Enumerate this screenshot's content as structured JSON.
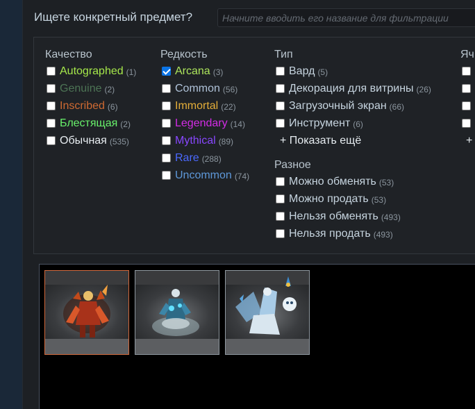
{
  "search": {
    "label": "Ищете конкретный предмет?",
    "placeholder": "Начните вводить его название для фильтрации"
  },
  "quality": {
    "title": "Качество",
    "items": [
      {
        "label": "Autographed",
        "count": "(1)",
        "color": "#a6e84a",
        "checked": false
      },
      {
        "label": "Genuine",
        "count": "(2)",
        "color": "#4d7455",
        "checked": false
      },
      {
        "label": "Inscribed",
        "count": "(6)",
        "color": "#cf6a32",
        "checked": false
      },
      {
        "label": "Блестящая",
        "count": "(2)",
        "color": "#68f16b",
        "checked": false
      },
      {
        "label": "Обычная",
        "count": "(535)",
        "color": "#e8edf1",
        "checked": false
      }
    ]
  },
  "rarity": {
    "title": "Редкость",
    "items": [
      {
        "label": "Arcana",
        "count": "(3)",
        "color": "#ade55c",
        "checked": true
      },
      {
        "label": "Common",
        "count": "(56)",
        "color": "#b0c3d9",
        "checked": false
      },
      {
        "label": "Immortal",
        "count": "(22)",
        "color": "#e4ae39",
        "checked": false
      },
      {
        "label": "Legendary",
        "count": "(14)",
        "color": "#d32ce6",
        "checked": false
      },
      {
        "label": "Mythical",
        "count": "(89)",
        "color": "#8847ff",
        "checked": false
      },
      {
        "label": "Rare",
        "count": "(288)",
        "color": "#4b69ff",
        "checked": false
      },
      {
        "label": "Uncommon",
        "count": "(74)",
        "color": "#5e98d9",
        "checked": false
      }
    ]
  },
  "type": {
    "title": "Тип",
    "items": [
      {
        "label": "Вард",
        "count": "(5)"
      },
      {
        "label": "Декорация для витрины",
        "count": "(26)"
      },
      {
        "label": "Загрузочный экран",
        "count": "(66)"
      },
      {
        "label": "Инструмент",
        "count": "(6)"
      }
    ],
    "show_more": "+ Показать ещё"
  },
  "misc": {
    "title": "Разное",
    "items": [
      {
        "label": "Можно обменять",
        "count": "(53)"
      },
      {
        "label": "Можно продать",
        "count": "(53)"
      },
      {
        "label": "Нельзя обменять",
        "count": "(493)"
      },
      {
        "label": "Нельзя продать",
        "count": "(493)"
      }
    ]
  },
  "slot": {
    "title": "Яч",
    "show_more": "+"
  },
  "results": {
    "items": [
      {
        "name": "arcana-item-1",
        "selected": true
      },
      {
        "name": "arcana-item-2",
        "selected": false
      },
      {
        "name": "arcana-item-3",
        "selected": false
      }
    ]
  }
}
